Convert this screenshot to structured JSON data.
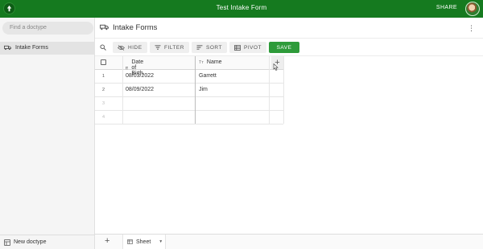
{
  "app": {
    "title": "Test Intake Form",
    "share_label": "SHARE",
    "brand_color": "#157a1f"
  },
  "sidebar": {
    "search_placeholder": "Find a doctype",
    "items": [
      {
        "label": "Intake Forms",
        "icon": "truck-icon"
      }
    ],
    "new_doctype_label": "New doctype"
  },
  "main": {
    "title": "Intake Forms",
    "toolbar": {
      "hide_label": "HIDE",
      "filter_label": "FILTER",
      "sort_label": "SORT",
      "pivot_label": "PIVOT",
      "save_label": "SAVE",
      "save_color": "#2e9b3a"
    }
  },
  "table": {
    "columns": [
      {
        "label": "Date of Birth",
        "icon": "calendar-icon"
      },
      {
        "label": "Name",
        "icon": "text-type-icon",
        "icon_text": "Tт"
      }
    ],
    "rows": [
      {
        "index": "1",
        "date_of_birth": "08/03/2022",
        "name": "Garrett"
      },
      {
        "index": "2",
        "date_of_birth": "08/09/2022",
        "name": "Jim"
      },
      {
        "index": "3",
        "date_of_birth": "",
        "name": ""
      },
      {
        "index": "4",
        "date_of_birth": "",
        "name": ""
      }
    ]
  },
  "bottom": {
    "sheet_tab_label": "Sheet"
  }
}
